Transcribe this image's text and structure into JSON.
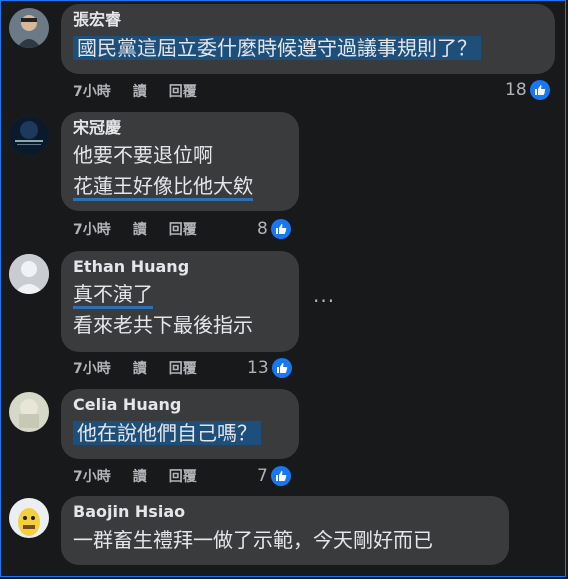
{
  "comments": [
    {
      "author": "張宏睿",
      "lines": [
        "國民黨這屆立委什麼時候遵守過議事規則了？"
      ],
      "time": "7小時",
      "read": "讀",
      "reply": "回覆",
      "likes": "18"
    },
    {
      "author": "宋冠慶",
      "lines": [
        "他要不要退位啊",
        "花蓮王好像比他大欸"
      ],
      "time": "7小時",
      "read": "讀",
      "reply": "回覆",
      "likes": "8"
    },
    {
      "author": "Ethan Huang",
      "lines": [
        "真不演了",
        "看來老共下最後指示"
      ],
      "time": "7小時",
      "read": "讀",
      "reply": "回覆",
      "likes": "13",
      "more": "···"
    },
    {
      "author": "Celia Huang",
      "lines": [
        "他在說他們自己嗎？"
      ],
      "time": "7小時",
      "read": "讀",
      "reply": "回覆",
      "likes": "7"
    },
    {
      "author": "Baojin Hsiao",
      "lines": [
        "一群畜生禮拜一做了示範，今天剛好而已"
      ]
    }
  ],
  "icons": {
    "like": "thumbs-up-icon",
    "more": "more-options-icon"
  },
  "colors": {
    "accent": "#1877f2",
    "bubble": "#3a3b3c",
    "background": "#18191a"
  }
}
